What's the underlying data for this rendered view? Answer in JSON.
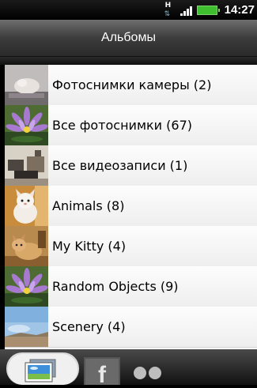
{
  "status": {
    "network_label": "H",
    "time": "14:27"
  },
  "header": {
    "title": "Альбомы"
  },
  "albums": [
    {
      "label": "Фотоснимки камеры (2)"
    },
    {
      "label": "Все фотоснимки (67)"
    },
    {
      "label": "Все видеозаписи (1)"
    },
    {
      "label": "Animals (8)"
    },
    {
      "label": "My Kitty (4)"
    },
    {
      "label": "Random Objects (9)"
    },
    {
      "label": "Scenery (4)"
    }
  ],
  "tabs": {
    "facebook_label": "f"
  }
}
